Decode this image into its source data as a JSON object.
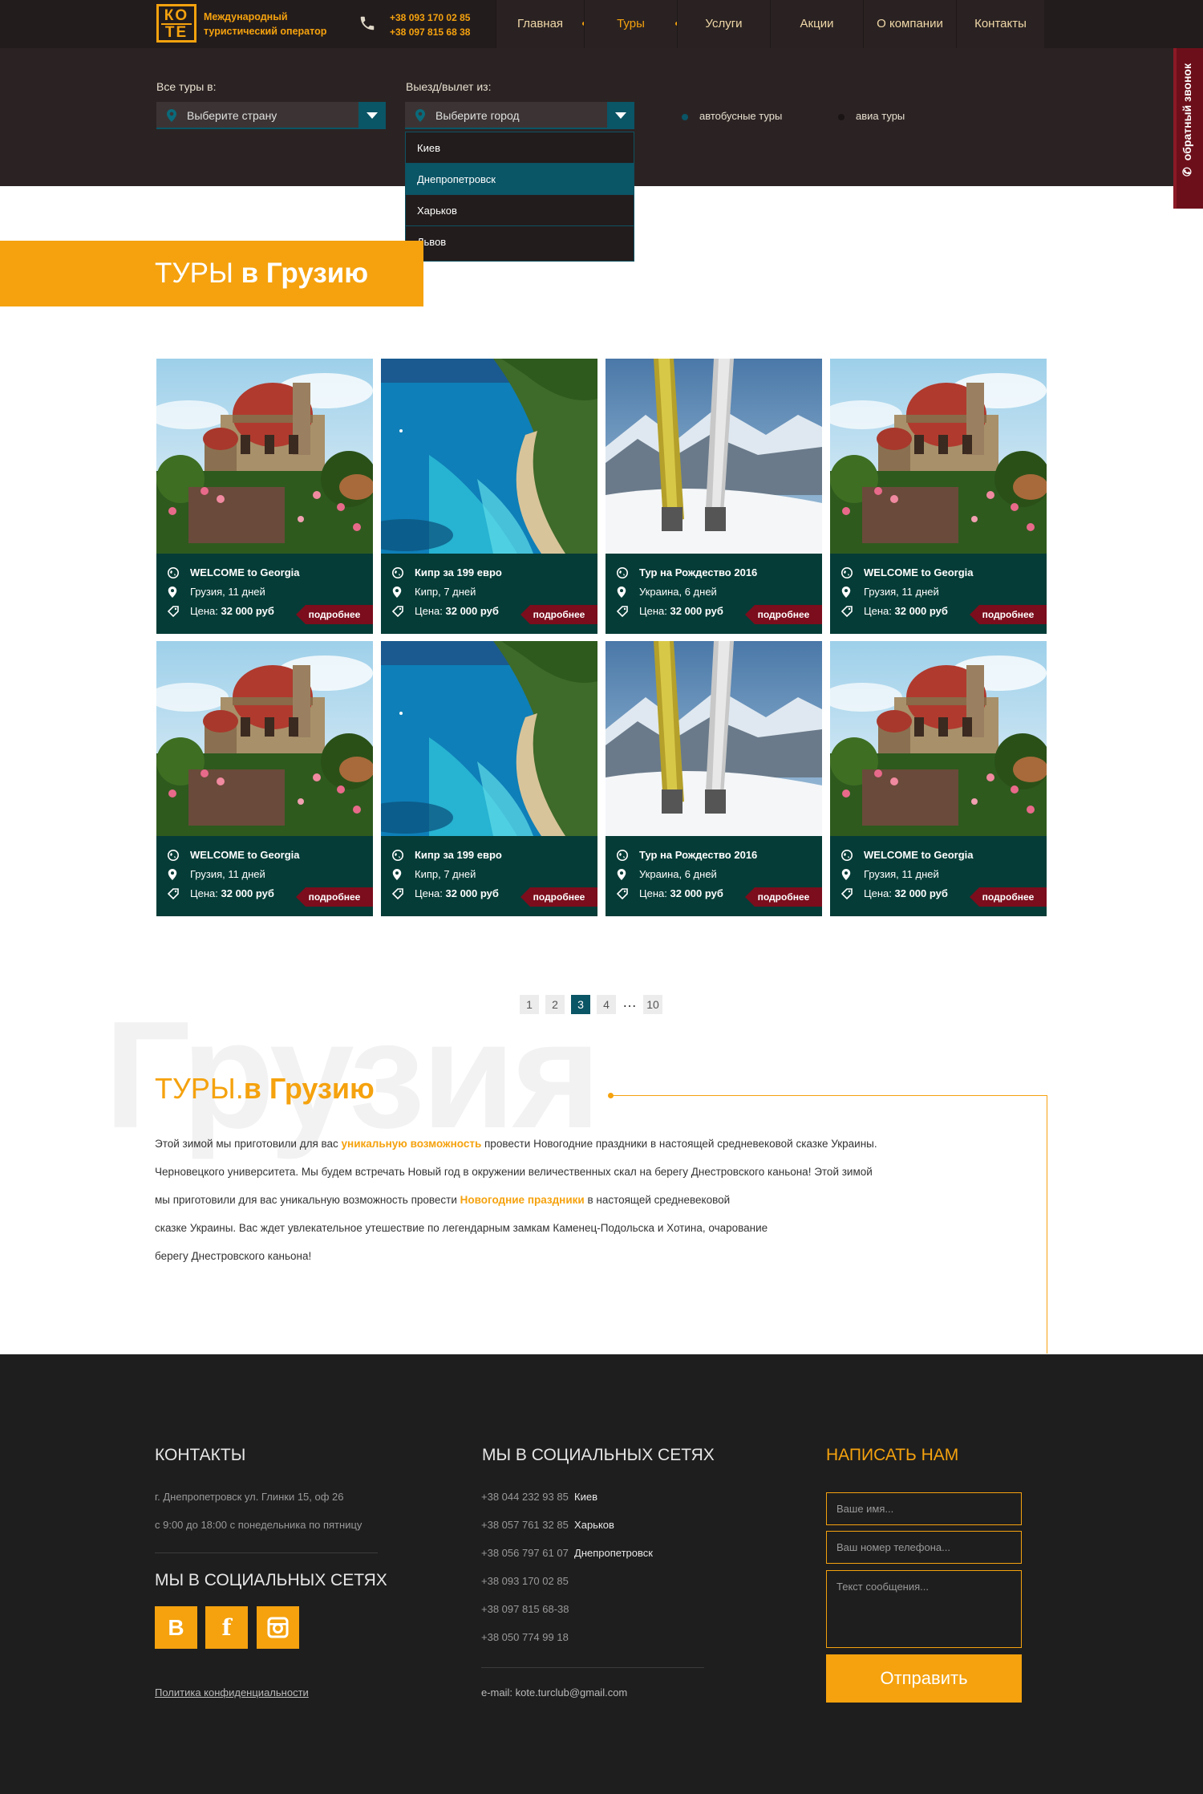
{
  "header": {
    "logo_top": "КО",
    "logo_bottom": "ТЕ",
    "tagline_1": "Международный",
    "tagline_2": "туристический оператор",
    "phone_1": "+38 093 170 02 85",
    "phone_2": "+38 097 815 68 38",
    "nav": [
      "Главная",
      "Туры",
      "Услуги",
      "Акции",
      "О компании",
      "Контакты"
    ]
  },
  "search": {
    "country_label": "Все туры в:",
    "country_placeholder": "Выберите страну",
    "city_label": "Выезд/вылет из:",
    "city_placeholder": "Выберите город",
    "cities": [
      "Киев",
      "Днепропетровск",
      "Харьков",
      "Львов"
    ],
    "highlighted_city": "Днепропетровск",
    "bus_tours": "автобусные туры",
    "air_tours": "авиа туры"
  },
  "callback": "обратный звонок",
  "page_title": {
    "prefix": "ТУРЫ ",
    "bold": "в Грузию"
  },
  "cards": [
    {
      "title": "WELCOME to Georgia",
      "place": "Грузия, 11 дней",
      "price_label": "Цена:",
      "price": "32 000 руб",
      "more": "подробнее",
      "image": "mosque"
    },
    {
      "title": "Кипр за 199 евро",
      "place": "Кипр, 7 дней",
      "price_label": "Цена:",
      "price": "32 000 руб",
      "more": "подробнее",
      "image": "beach"
    },
    {
      "title": "Тур на Рождество 2016",
      "place": "Украина, 6 дней",
      "price_label": "Цена:",
      "price": "32 000 руб",
      "more": "подробнее",
      "image": "skis"
    },
    {
      "title": "WELCOME to Georgia",
      "place": "Грузия, 11 дней",
      "price_label": "Цена:",
      "price": "32 000 руб",
      "more": "подробнее",
      "image": "mosque"
    },
    {
      "title": "WELCOME to Georgia",
      "place": "Грузия, 11 дней",
      "price_label": "Цена:",
      "price": "32 000 руб",
      "more": "подробнее",
      "image": "mosque"
    },
    {
      "title": "Кипр за 199 евро",
      "place": "Кипр, 7 дней",
      "price_label": "Цена:",
      "price": "32 000 руб",
      "more": "подробнее",
      "image": "beach"
    },
    {
      "title": "Тур на Рождество 2016",
      "place": "Украина, 6 дней",
      "price_label": "Цена:",
      "price": "32 000 руб",
      "more": "подробнее",
      "image": "skis"
    },
    {
      "title": "WELCOME to Georgia",
      "place": "Грузия, 11 дней",
      "price_label": "Цена:",
      "price": "32 000 руб",
      "more": "подробнее",
      "image": "mosque"
    }
  ],
  "pagination": {
    "pages": [
      "1",
      "2",
      "3",
      "4",
      "…",
      "10"
    ],
    "current": "3"
  },
  "seo": {
    "watermark": "Грузия",
    "title_prefix": "ТУРЫ.",
    "title_bold": "в Грузию",
    "p1_a": "Этой зимой мы приготовили для вас ",
    "p1_hl": "уникальную возможность",
    "p1_b": " провести Новогодние праздники в настоящей средневековой сказке Украины.",
    "p2": "Черновецкого университета. Мы будем встречать Новый год в окружении величественных скал на берегу Днестровского каньона! Этой зимой",
    "p3_a": "мы приготовили для вас уникальную возможность провести ",
    "p3_hl": "Новогодние праздники",
    "p3_b": " в настоящей средневековой",
    "p4": "сказке Украины. Вас ждет увлекательное утешествие по легендарным замкам Каменец-Подольска и Хотина, очарование",
    "p5": "берегу Днестровского каньона!"
  },
  "footer": {
    "contacts_title": "КОНТАКТЫ",
    "address": "г. Днепропетровск ул. Глинки 15, оф 26",
    "hours": "с 9:00 до 18:00 с понедельника по пятницу",
    "social_title": "МЫ В СОЦИАЛЬНЫХ СЕТЯХ",
    "social": [
      "В",
      "f",
      "instagram"
    ],
    "privacy": "Политика конфиденциальности",
    "social_title_2": "МЫ В СОЦИАЛЬНЫХ СЕТЯХ",
    "phones": [
      {
        "num": "+38 044 232 93 85",
        "city": "Киев"
      },
      {
        "num": "+38 057 761 32 85",
        "city": "Харьков"
      },
      {
        "num": "+38 056 797 61 07",
        "city": "Днепропетровск"
      },
      {
        "num": "+38 093 170 02 85",
        "city": ""
      },
      {
        "num": "+38 097 815 68-38",
        "city": ""
      },
      {
        "num": "+38 050 774 99 18",
        "city": ""
      }
    ],
    "email": "e-mail: kote.turclub@gmail.com",
    "write_title": "НАПИСАТЬ НАМ",
    "name_placeholder": "Ваше имя...",
    "phone_placeholder": "Ваш номер телефона...",
    "message_placeholder": "Текст сообщения...",
    "send": "Отправить"
  },
  "colors": {
    "accent": "#f5a20e",
    "teal": "#0a5566",
    "card_body": "#053c37",
    "more_btn": "#7b0d1c",
    "header": "#231c1c",
    "footer": "#1e1e1e"
  }
}
